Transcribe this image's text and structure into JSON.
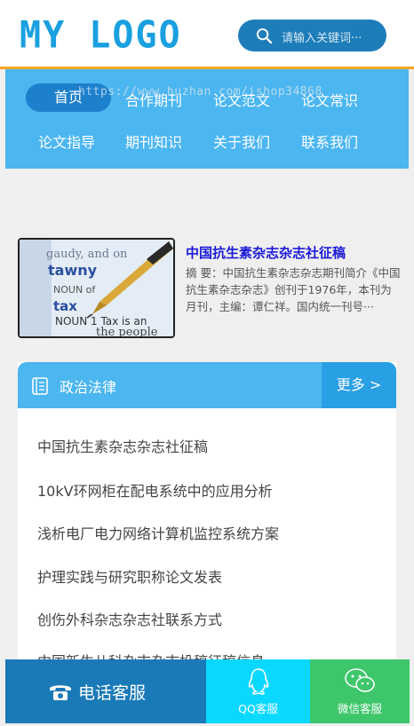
{
  "header": {
    "logo_text": "MY LOGO",
    "search_placeholder": "请输入关键词···"
  },
  "nav": {
    "watermark": "https://www.huzhan.com/ishop34868",
    "items": [
      {
        "label": "首页",
        "active": true
      },
      {
        "label": "合作期刊"
      },
      {
        "label": "论文范文"
      },
      {
        "label": "论文常识"
      },
      {
        "label": "论文指导"
      },
      {
        "label": "期刊知识"
      },
      {
        "label": "关于我们"
      },
      {
        "label": "联系我们"
      }
    ]
  },
  "featured": {
    "title": "中国抗生素杂志杂志社征稿",
    "summary": "摘 要：中国抗生素杂志杂志期刊简介《中国抗生素杂志杂志》创刊于1976年，本刊为月刊，主编：谭仁祥。国内统一刊号···",
    "image_words": {
      "w1": "gaudy, and on",
      "w2": "tawny",
      "w3": "NOUN of",
      "w4": "tax",
      "w5": "NOUN 1 Tax is an",
      "w6": "the people"
    }
  },
  "section": {
    "title": "政治法律",
    "more": "更多 >",
    "items": [
      "中国抗生素杂志杂志社征稿",
      "10kV环网柜在配电系统中的应用分析",
      "浅析电厂电力网络计算机监控系统方案",
      "护理实践与研究职称论文发表",
      "创伤外科杂志杂志社联系方式",
      "中国新生儿科杂志杂志投稿征稿信息"
    ]
  },
  "footer": {
    "phone": "电话客服",
    "qq": "QQ客服",
    "wechat": "微信客服"
  },
  "colors": {
    "accent": "#1aa0e0",
    "nav_bg": "#4bb6ef",
    "phone_bg": "#1a7ab8",
    "qq_bg": "#0ad8ff",
    "wechat_bg": "#3ec66b",
    "header_line": "#f5a623"
  }
}
